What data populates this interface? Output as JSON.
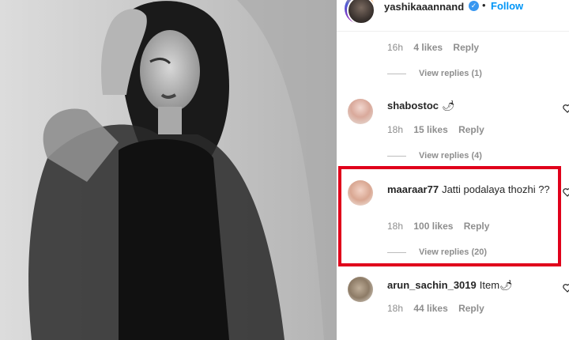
{
  "post": {
    "username": "yashikaaannand",
    "verified_icon": "verified-badge-icon",
    "separator": "•",
    "follow_label": "Follow"
  },
  "first_comment_meta": {
    "time": "16h",
    "likes": "4 likes",
    "reply": "Reply",
    "view_replies": "View replies (1)"
  },
  "comments": [
    {
      "username": "shabostoc",
      "text": "🌶",
      "time": "18h",
      "likes": "15 likes",
      "reply": "Reply",
      "view_replies": "View replies (4)"
    },
    {
      "username": "maaraar77",
      "text": "Jatti podalaya thozhi ??",
      "time": "18h",
      "likes": "100 likes",
      "reply": "Reply",
      "view_replies": "View replies (20)"
    },
    {
      "username": "arun_sachin_3019",
      "text": "Item🌶",
      "time": "18h",
      "likes": "44 likes",
      "reply": "Reply"
    }
  ],
  "colors": {
    "accent": "#0095f6",
    "verified": "#3897f0",
    "highlight": "#e0001b",
    "muted": "#8e8e8e"
  }
}
